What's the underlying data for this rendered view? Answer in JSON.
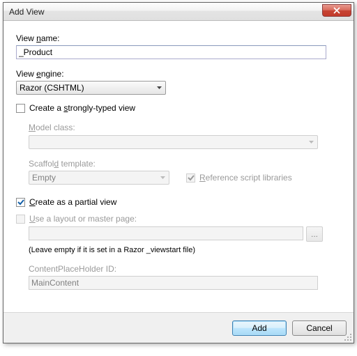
{
  "window": {
    "title": "Add View"
  },
  "viewName": {
    "label": "View name:",
    "value": "_Product"
  },
  "viewEngine": {
    "label": "View engine:",
    "value": "Razor (CSHTML)"
  },
  "stronglyTyped": {
    "label": "Create a strongly-typed view"
  },
  "modelClass": {
    "label": "Model class:",
    "value": ""
  },
  "scaffold": {
    "label": "Scaffold template:",
    "value": "Empty"
  },
  "refScripts": {
    "label": "Reference script libraries"
  },
  "partial": {
    "label": "Create as a partial view"
  },
  "useLayout": {
    "label": "Use a layout or master page:"
  },
  "layoutHint": "(Leave empty if it is set in a Razor _viewstart file)",
  "cph": {
    "label": "ContentPlaceHolder ID:",
    "value": "MainContent"
  },
  "browse": {
    "label": "..."
  },
  "buttons": {
    "add": "Add",
    "cancel": "Cancel"
  }
}
